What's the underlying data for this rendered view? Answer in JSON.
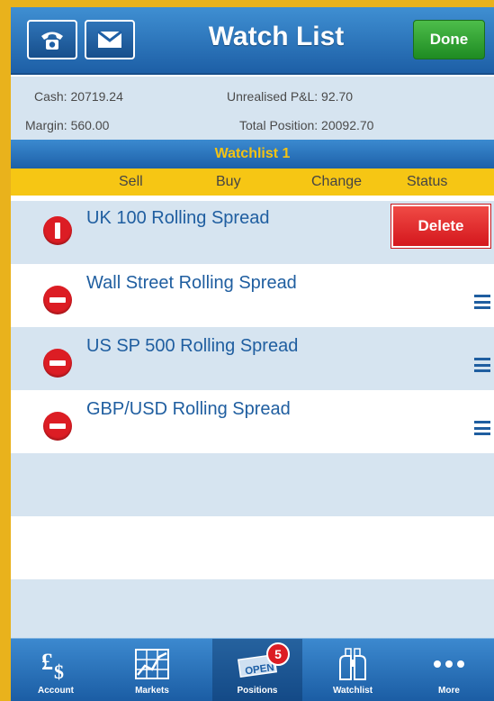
{
  "header": {
    "title": "Watch List",
    "done_label": "Done"
  },
  "account": {
    "cash": "Cash: 20719.24",
    "unrealised_pl": "Unrealised P&L: 92.70",
    "margin": "Margin: 560.00",
    "total_position": "Total Position: 20092.70"
  },
  "watchlist": {
    "name": "Watchlist 1",
    "columns": [
      "Sell",
      "Buy",
      "Change",
      "Status"
    ],
    "items": [
      {
        "label": "UK 100 Rolling Spread",
        "delete_label": "Delete"
      },
      {
        "label": "Wall Street Rolling Spread"
      },
      {
        "label": "US SP 500  Rolling Spread"
      },
      {
        "label": "GBP/USD Rolling Spread"
      }
    ]
  },
  "tabbar": {
    "tabs": [
      {
        "label": "Account",
        "icon": "pound-dollar-icon"
      },
      {
        "label": "Markets",
        "icon": "chart-grid-icon"
      },
      {
        "label": "Positions",
        "icon": "open-sign-icon",
        "badge": "5"
      },
      {
        "label": "Watchlist",
        "icon": "binoculars-icon"
      },
      {
        "label": "More",
        "icon": "more-dots-icon"
      }
    ]
  },
  "colors": {
    "header_blue": "#1d5fa6",
    "accent_yellow": "#f6c614",
    "delete_red": "#d4171d",
    "done_green": "#1e8b22"
  }
}
